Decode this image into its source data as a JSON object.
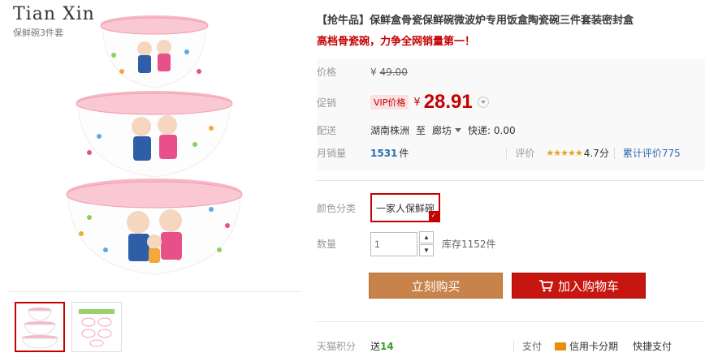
{
  "brand": {
    "name": "Tian Xin",
    "subtitle": "保鲜碗3件套"
  },
  "product": {
    "title": "【抢牛品】保鲜盒骨瓷保鲜碗微波炉专用饭盒陶瓷碗三件套装密封盒",
    "subtitle": "高档骨瓷碗，力争全网销量第一！"
  },
  "price": {
    "label": "价格",
    "currency": "¥",
    "original": "49.00"
  },
  "promo": {
    "label": "促销",
    "badge": "VIP价格",
    "currency": "¥",
    "price": "28.91"
  },
  "delivery": {
    "label": "配送",
    "from": "湖南株洲",
    "to_word": "至",
    "to": "廊坊",
    "shipping": "快递: 0.00"
  },
  "sales": {
    "label": "月销量",
    "count": "1531",
    "unit": "件",
    "rating_label": "评价",
    "stars": "★★★★★",
    "rating": "4.7分",
    "reviews_label": "累计评价",
    "reviews_count": "775"
  },
  "sku": {
    "label": "颜色分类",
    "option": "一家人保鲜碗"
  },
  "quantity": {
    "label": "数量",
    "value": "1",
    "stock": "库存1152件"
  },
  "actions": {
    "buy": "立刻购买",
    "cart": "加入购物车"
  },
  "footer": {
    "points_label": "天猫积分",
    "points_prefix": "送",
    "points_value": "14",
    "pay_label": "支付",
    "credit": "信用卡分期",
    "quick_pay": "快捷支付"
  },
  "colors": {
    "accent": "#c40000",
    "buy_button": "#c7834a",
    "cart_button": "#c7160f",
    "link_blue": "#2d6bb3",
    "star": "#e8a317"
  },
  "icons": [
    "cart-icon",
    "credit-card-icon",
    "chevron-down-icon",
    "caret-down-icon",
    "check-corner-icon"
  ]
}
